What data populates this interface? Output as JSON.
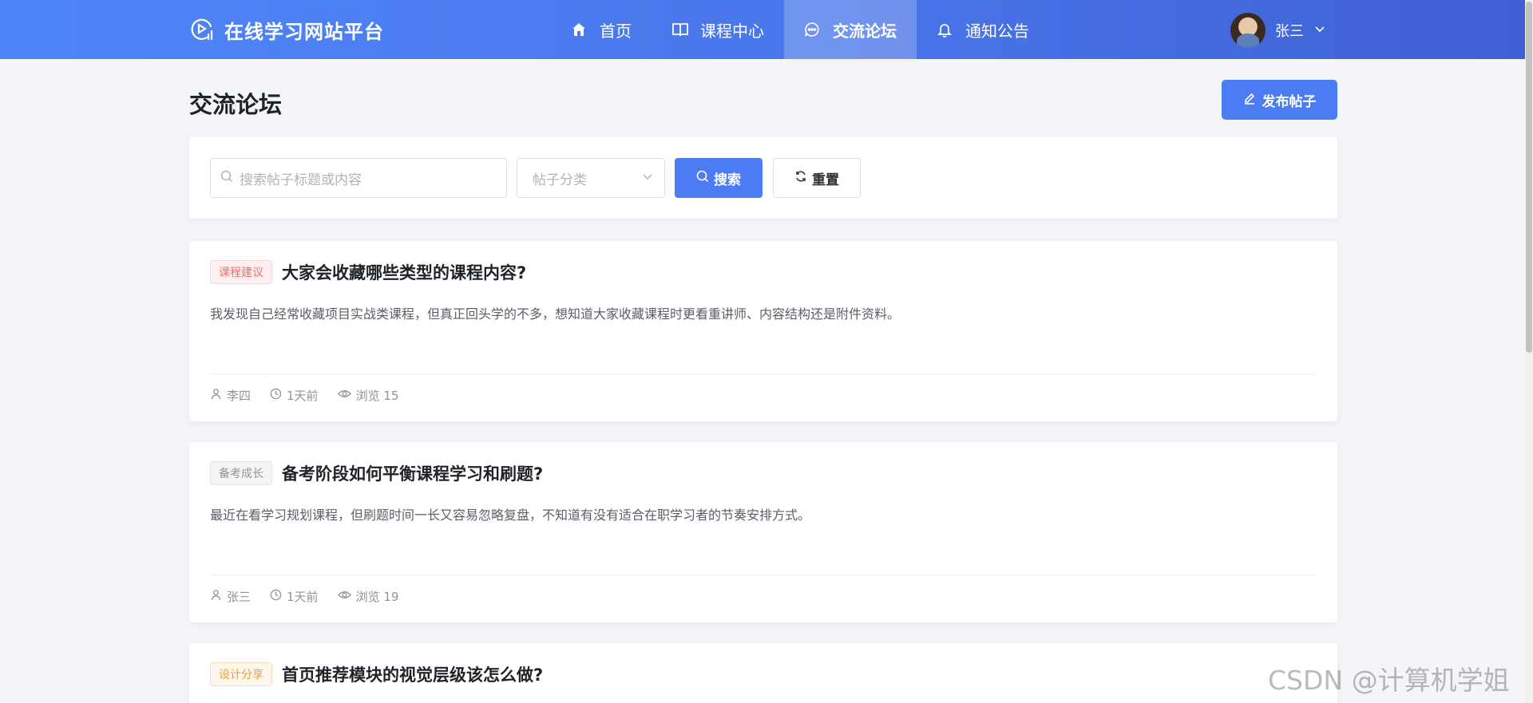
{
  "header": {
    "brand_title": "在线学习网站平台",
    "nav": [
      {
        "label": "首页",
        "icon": "home-icon"
      },
      {
        "label": "课程中心",
        "icon": "book-icon"
      },
      {
        "label": "交流论坛",
        "icon": "chat-icon",
        "active": true
      },
      {
        "label": "通知公告",
        "icon": "bell-icon"
      }
    ],
    "user_name": "张三"
  },
  "page": {
    "title": "交流论坛",
    "post_button_label": "发布帖子"
  },
  "filters": {
    "search_placeholder": "搜索帖子标题或内容",
    "category_placeholder": "帖子分类",
    "search_label": "搜索",
    "reset_label": "重置"
  },
  "posts": [
    {
      "tag": "课程建议",
      "tag_color": "#f56c6c",
      "title": "大家会收藏哪些类型的课程内容?",
      "summary": "我发现自己经常收藏项目实战类课程，但真正回头学的不多，想知道大家收藏课程时更看重讲师、内容结构还是附件资料。",
      "author": "李四",
      "time": "1天前",
      "views": "浏览 15"
    },
    {
      "tag": "备考成长",
      "tag_color": "#909399",
      "title": "备考阶段如何平衡课程学习和刷题?",
      "summary": "最近在看学习规划课程，但刷题时间一长又容易忽略复盘，不知道有没有适合在职学习者的节奏安排方式。",
      "author": "张三",
      "time": "1天前",
      "views": "浏览 19"
    },
    {
      "tag": "设计分享",
      "tag_color": "#e6a23c",
      "title": "首页推荐模块的视觉层级该怎么做?"
    }
  ],
  "watermark": "CSDN @计算机学姐"
}
